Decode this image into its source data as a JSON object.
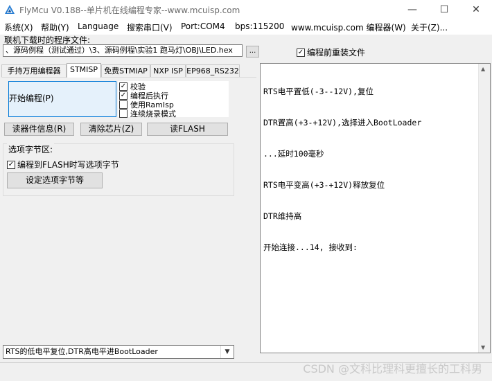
{
  "window": {
    "title": "FlyMcu V0.188--单片机在线编程专家--www.mcuisp.com",
    "minimize": "—",
    "maximize": "☐",
    "close": "✕"
  },
  "menu": [
    "系统(X)",
    "帮助(Y)",
    "Language",
    "搜索串口(V)",
    "Port:COM4",
    "bps:115200",
    "www.mcuisp.com 编程器(W)",
    "关于(Z)..."
  ],
  "program_file": {
    "label": "联机下载时的程序文件:",
    "path": "、源码例程（测试通过）\\3、源码例程\\实验1 跑马灯\\OBJ\\LED.hex",
    "browse_label": "...",
    "reload_label": "编程前重装文件",
    "reload_checked": true
  },
  "tabs": [
    "手持万用编程器",
    "STMISP",
    "免费STMIAP",
    "NXP ISP",
    "EP968_RS232"
  ],
  "active_tab": 1,
  "stmisp": {
    "start_label": "开始编程(P)",
    "options": [
      {
        "label": "校验",
        "checked": true
      },
      {
        "label": "编程后执行",
        "checked": true
      },
      {
        "label": "使用RamIsp",
        "checked": false
      },
      {
        "label": "连续烧录模式",
        "checked": false
      }
    ],
    "read_info_label": "读器件信息(R)",
    "erase_label": "清除芯片(Z)",
    "read_flash_label": "读FLASH",
    "option_bytes": {
      "group_label": "选项字节区:",
      "write_label": "编程到FLASH时写选项字节",
      "write_checked": true,
      "set_label": "设定选项字节等"
    }
  },
  "log": {
    "lines": [
      "RTS电平置低(-3--12V),复位",
      "DTR置高(+3-+12V),选择进入BootLoader",
      "...延时100毫秒",
      "RTS电平变高(+3-+12V)释放复位",
      "DTR维持高",
      "开始连接...14, 接收到:"
    ]
  },
  "reset_mode": {
    "selected": "RTS的低电平复位,DTR高电平进BootLoader"
  },
  "watermark": "CSDN @文科比理科更擅长的工科男"
}
